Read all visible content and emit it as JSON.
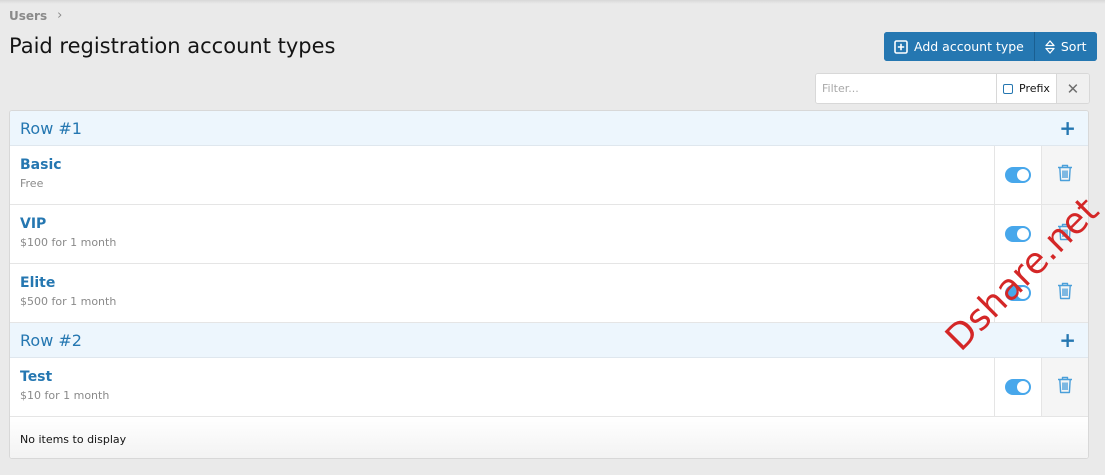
{
  "breadcrumb": {
    "items": [
      "Users"
    ]
  },
  "page": {
    "title": "Paid registration account types"
  },
  "toolbar": {
    "add_label": "Add account type",
    "sort_label": "Sort"
  },
  "filter": {
    "placeholder": "Filter...",
    "prefix_label": "Prefix",
    "prefix_checked": false
  },
  "sections": [
    {
      "label": "Row #1",
      "items": [
        {
          "name": "Basic",
          "desc": "Free",
          "enabled": true
        },
        {
          "name": "VIP",
          "desc": "$100 for 1 month",
          "enabled": true
        },
        {
          "name": "Elite",
          "desc": "$500 for 1 month",
          "enabled": true
        }
      ]
    },
    {
      "label": "Row #2",
      "items": [
        {
          "name": "Test",
          "desc": "$10 for 1 month",
          "enabled": true
        }
      ]
    }
  ],
  "footer": {
    "text": "No items to display"
  },
  "watermark": {
    "text": "Dshare.net"
  },
  "colors": {
    "accent": "#2577b1",
    "toggle_on": "#47a7eb",
    "section_bg": "#edf6fd",
    "watermark": "#d42727"
  }
}
